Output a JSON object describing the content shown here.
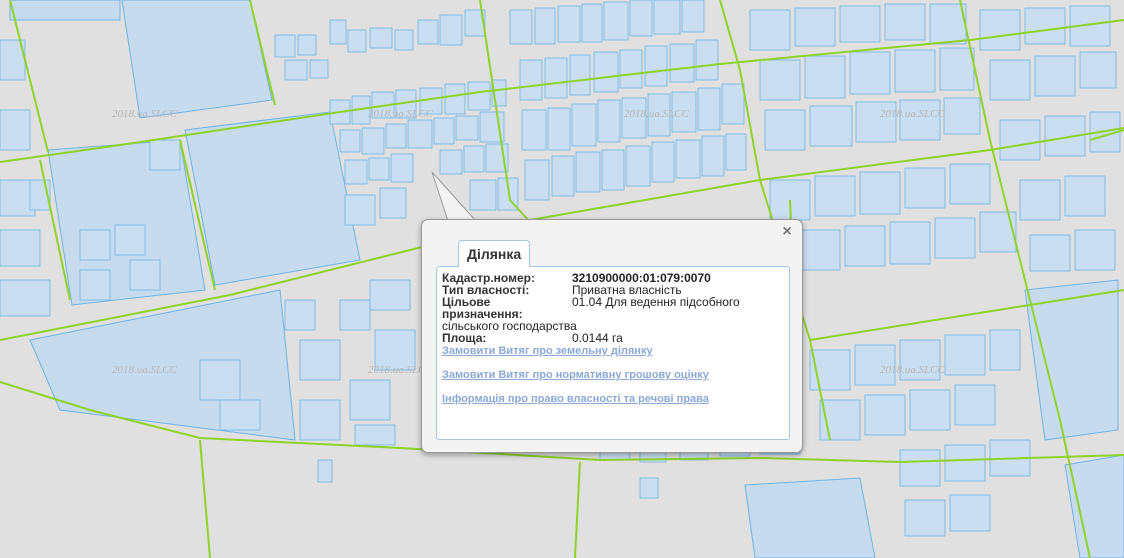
{
  "map": {
    "watermark": "2018.ua.SLCC",
    "colors": {
      "background": "#e0e0e0",
      "parcel_fill": "#c6dbee",
      "parcel_stroke": "#6fb3e6",
      "road": "#8fd22a"
    }
  },
  "popup": {
    "tab_label": "Ділянка",
    "close_icon": "×",
    "fields": [
      {
        "label": "Кадастр.номер:",
        "value": "3210900000:01:079:0070"
      },
      {
        "label": "Тип власності:",
        "value": "Приватна власність"
      },
      {
        "label": "Цільове призначення:",
        "value": "01.04 Для ведення підсобного"
      },
      {
        "label": "",
        "value": "сільського господарства"
      },
      {
        "label": "Площа:",
        "value": "0.0144 га"
      }
    ],
    "links": [
      "Замовити Витяг про земельну ділянку",
      "Замовити Витяг про нормативну грошову оцінку",
      "Інформація про право власності та речові права"
    ]
  }
}
